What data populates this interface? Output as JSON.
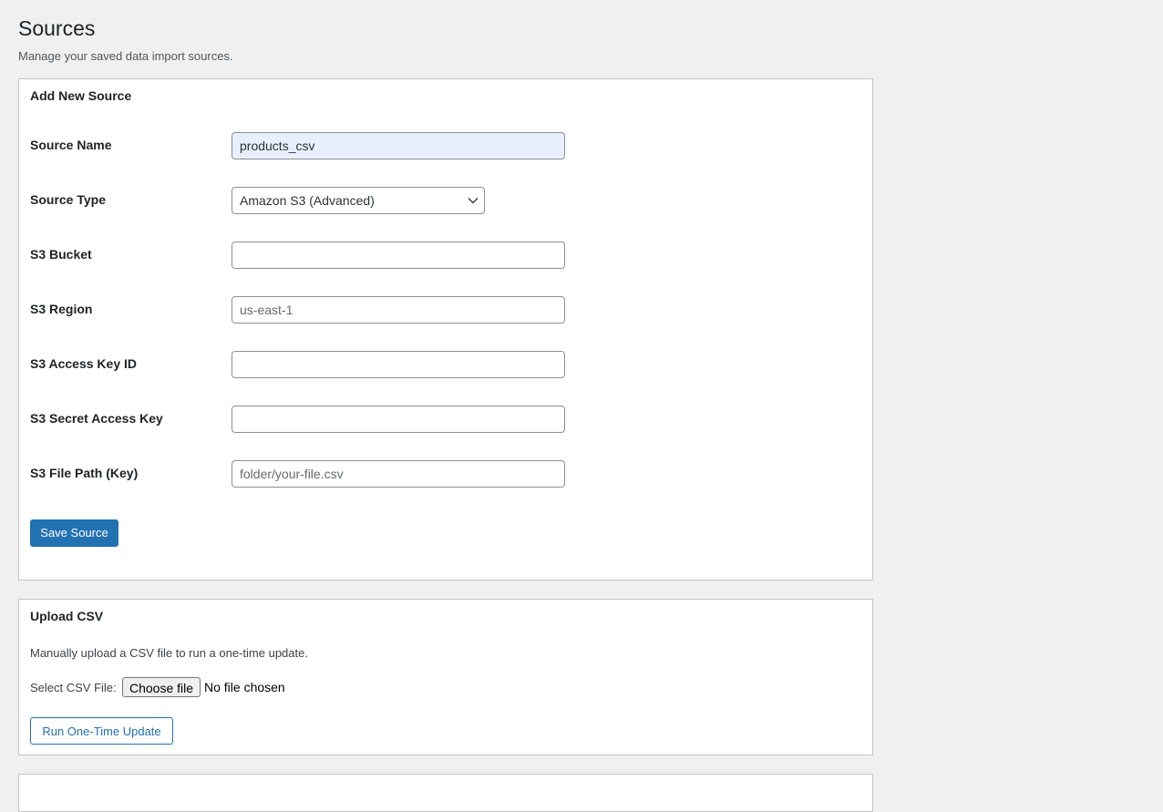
{
  "page": {
    "title": "Sources",
    "subtitle": "Manage your saved data import sources."
  },
  "add_source": {
    "title": "Add New Source",
    "fields": {
      "source_name": {
        "label": "Source Name",
        "value": "products_csv",
        "placeholder": ""
      },
      "source_type": {
        "label": "Source Type",
        "value": "Amazon S3 (Advanced)"
      },
      "s3_bucket": {
        "label": "S3 Bucket",
        "value": "",
        "placeholder": ""
      },
      "s3_region": {
        "label": "S3 Region",
        "value": "",
        "placeholder": "us-east-1"
      },
      "s3_access_key": {
        "label": "S3 Access Key ID",
        "value": "",
        "placeholder": ""
      },
      "s3_secret_key": {
        "label": "S3 Secret Access Key",
        "value": "",
        "placeholder": ""
      },
      "s3_file_path": {
        "label": "S3 File Path (Key)",
        "value": "",
        "placeholder": "folder/your-file.csv"
      }
    },
    "save_label": "Save Source"
  },
  "upload_csv": {
    "title": "Upload CSV",
    "description": "Manually upload a CSV file to run a one-time update.",
    "file_label": "Select CSV File:",
    "choose_file_label": "Choose file",
    "no_file_text": "No file chosen",
    "run_label": "Run One-Time Update"
  },
  "colors": {
    "primary": "#2271b1",
    "background": "#f0f0f1",
    "focused_input": "#e8f0fe"
  }
}
